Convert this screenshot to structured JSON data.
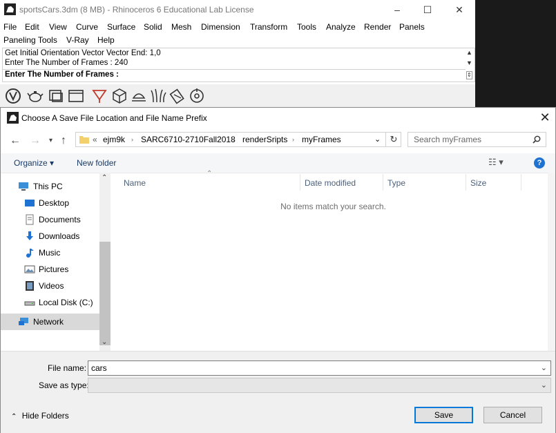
{
  "rhino": {
    "title": "sportsCars.3dm (8 MB) - Rhinoceros 6 Educational Lab License",
    "menu_row1": [
      "File",
      "Edit",
      "View",
      "Curve",
      "Surface",
      "Solid",
      "Mesh",
      "Dimension",
      "Transform",
      "Tools",
      "Analyze",
      "Render",
      "Panels"
    ],
    "menu_row2": [
      "Paneling Tools",
      "V-Ray",
      "Help"
    ],
    "command_lines": [
      "Get Initial Orientation Vector Vector End: 1,0",
      "Enter The Number of Frames : 240"
    ],
    "command_prompt": "Enter The Number of Frames :",
    "toolbar_icons": [
      "vray-logo-icon",
      "teapot-icon",
      "frame-buffer-icon",
      "window-icon",
      "render-interactive-icon",
      "cube-icon",
      "light-icon",
      "grass-icon",
      "material-icon",
      "settings-icon"
    ]
  },
  "dialog": {
    "title": "Choose A Save File Location and File Name Prefix",
    "breadcrumb": [
      "«",
      "ejm9k",
      "SARC6710-2710Fall2018",
      "renderSripts",
      "myFrames"
    ],
    "search_placeholder": "Search myFrames",
    "organize_label": "Organize ▾",
    "new_folder_label": "New folder",
    "nav_items": [
      {
        "label": "This PC",
        "icon": "pc-icon"
      },
      {
        "label": "Desktop",
        "icon": "desktop-icon"
      },
      {
        "label": "Documents",
        "icon": "documents-icon"
      },
      {
        "label": "Downloads",
        "icon": "downloads-icon"
      },
      {
        "label": "Music",
        "icon": "music-icon"
      },
      {
        "label": "Pictures",
        "icon": "pictures-icon"
      },
      {
        "label": "Videos",
        "icon": "videos-icon"
      },
      {
        "label": "Local Disk (C:)",
        "icon": "disk-icon"
      },
      {
        "label": "Network",
        "icon": "network-icon"
      }
    ],
    "columns": [
      "Name",
      "Date modified",
      "Type",
      "Size"
    ],
    "empty_message": "No items match your search.",
    "file_name_label": "File name:",
    "file_name_value": "cars",
    "save_type_label": "Save as type:",
    "save_type_value": "",
    "hide_folders_label": "Hide Folders",
    "save_button": "Save",
    "cancel_button": "Cancel"
  }
}
